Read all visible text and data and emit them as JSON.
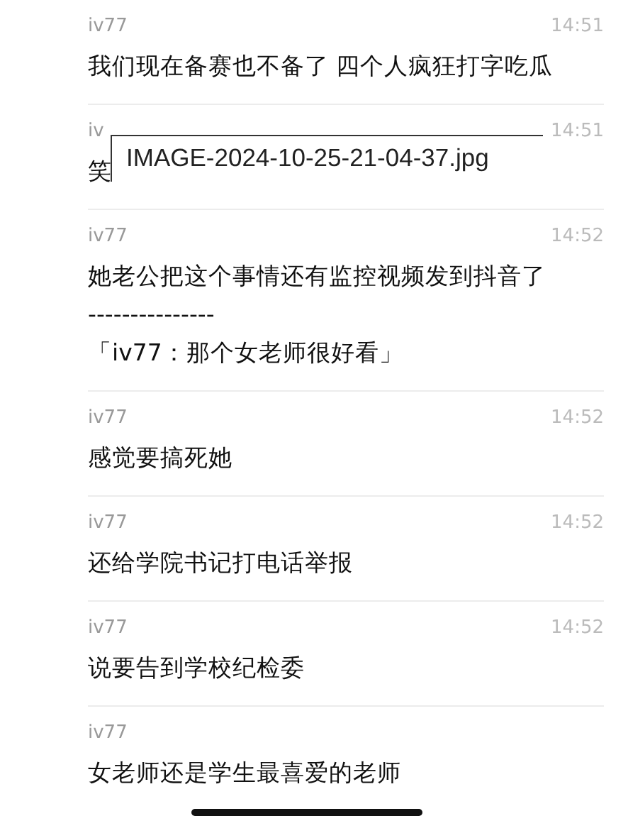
{
  "messages": [
    {
      "sender": "iv77",
      "time": "14:51",
      "lines": [
        "我们现在备赛也不备了 四个人疯狂打字吃瓜"
      ]
    },
    {
      "sender": "iv",
      "time": "14:51",
      "lines": [
        "笑"
      ],
      "tooltip": "IMAGE-2024-10-25-21-04-37.jpg"
    },
    {
      "sender": "iv77",
      "time": "14:52",
      "lines": [
        "她老公把这个事情还有监控视频发到抖音了",
        "---------------",
        "「iv77：那个女老师很好看」"
      ]
    },
    {
      "sender": "iv77",
      "time": "14:52",
      "lines": [
        "感觉要搞死她"
      ]
    },
    {
      "sender": "iv77",
      "time": "14:52",
      "lines": [
        "还给学院书记打电话举报"
      ]
    },
    {
      "sender": "iv77",
      "time": "14:52",
      "lines": [
        "说要告到学校纪检委"
      ]
    },
    {
      "sender": "iv77",
      "lines": [
        "女老师还是学生最喜爱的老师"
      ]
    }
  ]
}
